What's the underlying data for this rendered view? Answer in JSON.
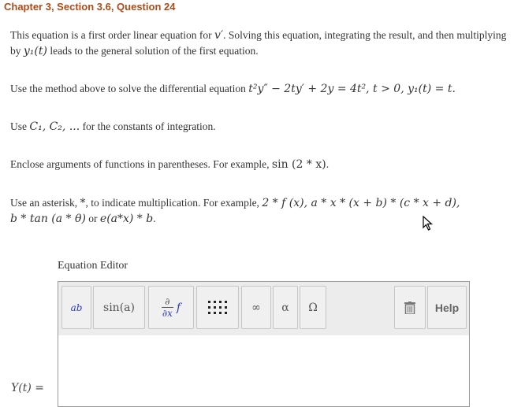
{
  "header": {
    "title": "Chapter 3, Section 3.6, Question 24"
  },
  "intro": {
    "text_a": "This equation is a first order linear equation for ",
    "var_v": "v′",
    "text_b": ". Solving this equation, integrating the result, and then multiplying by ",
    "y1t": "y₁(t)",
    "text_c": " leads to the general solution of the first equation."
  },
  "problem": {
    "text": "Use the method above to solve the differential equation ",
    "equation": "t²y″ − 2ty′ + 2y = 4t²,  t > 0,  y₁(t) = t."
  },
  "constants": {
    "text_a": "Use ",
    "c1": "C₁, C₂, ...",
    "text_b": " for the constants of integration."
  },
  "enclose": {
    "text": "Enclose arguments of functions in parentheses. For example, ",
    "example": "sin (2 * x)",
    "end": "."
  },
  "asterisk": {
    "text_a": "Use an asterisk, ",
    "star": "*",
    "text_b": ", to indicate multiplication. For example, ",
    "example1": "2 * f (x), a * x * (x + b) * (c * x + d),",
    "example2": "b * tan (a * θ)",
    "or": " or ",
    "example3": "e(a*x) * b",
    "end": "."
  },
  "editor": {
    "label": "Equation Editor",
    "buttons": {
      "power": "ab",
      "sin": "sin(a)",
      "deriv_top": "∂",
      "deriv_bottom": "∂x",
      "deriv_f": "f",
      "infinity": "∞",
      "alpha": "α",
      "omega": "Ω",
      "help": "Help"
    }
  },
  "answer": {
    "label": "Y(t) ="
  }
}
